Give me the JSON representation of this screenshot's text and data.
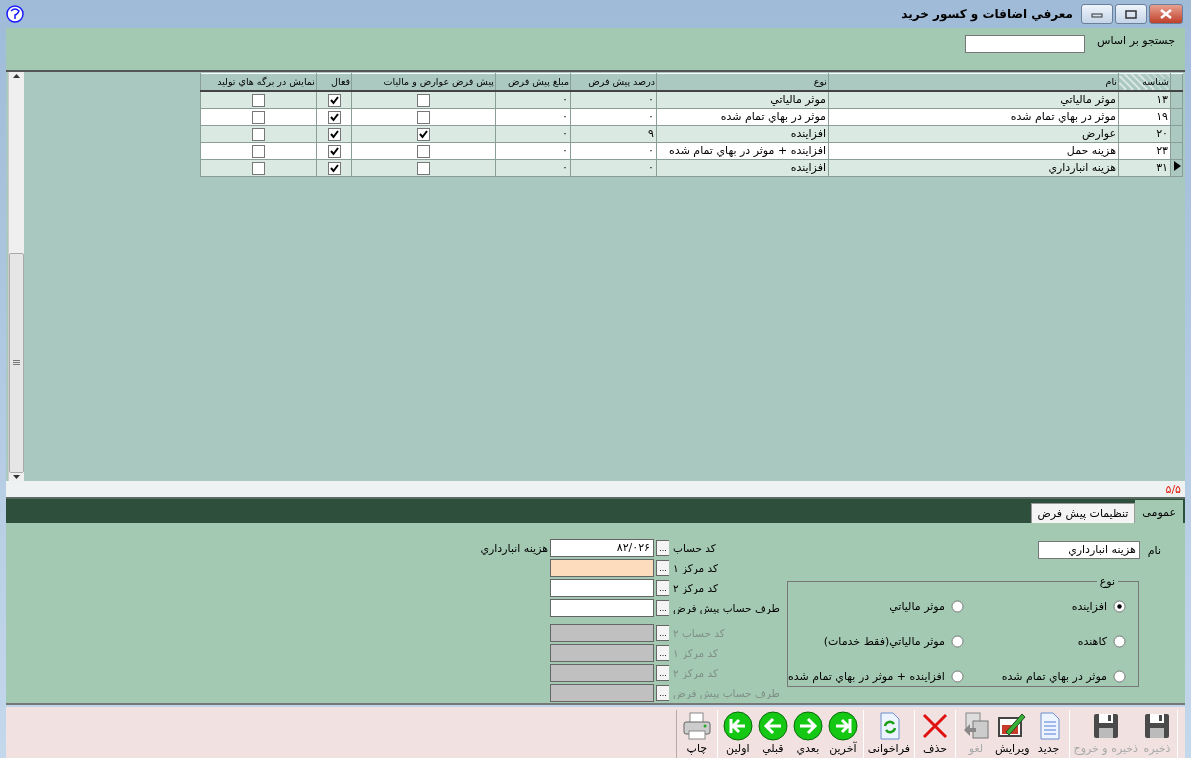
{
  "window": {
    "title": "معرفي اضافات و کسور خريد"
  },
  "search": {
    "label": "جستجو بر اساس"
  },
  "grid": {
    "columns": [
      {
        "label": "شناسه",
        "sorted": true
      },
      {
        "label": "نام",
        "sorted": false
      },
      {
        "label": "نوع",
        "sorted": false
      },
      {
        "label": "درصد پیش فرض",
        "sorted": false
      },
      {
        "label": "مبلغ پیش فرض",
        "sorted": false
      },
      {
        "label": "پیش فرض عوارض و مالیات",
        "sorted": false
      },
      {
        "label": "فعال",
        "sorted": false
      },
      {
        "label": "نمایش در برگه هاي تولید",
        "sorted": false
      }
    ],
    "rows": [
      {
        "current": false,
        "id": "۱۳",
        "name": "موثر مالیاتي",
        "type": "موثر مالیاتي",
        "percent": "۰",
        "amount": "۰",
        "tax_default": false,
        "active": true,
        "show_in_production": false
      },
      {
        "current": false,
        "id": "۱۹",
        "name": "موثر در بهاي تمام شده",
        "type": "موثر در بهاي تمام شده",
        "percent": "۰",
        "amount": "۰",
        "tax_default": false,
        "active": true,
        "show_in_production": false
      },
      {
        "current": false,
        "id": "۲۰",
        "name": "عوارض",
        "type": "افزاینده",
        "percent": "۹",
        "amount": "۰",
        "tax_default": true,
        "active": true,
        "show_in_production": false
      },
      {
        "current": false,
        "id": "۲۳",
        "name": "هزینه حمل",
        "type": "افزاینده + موثر در بهاي تمام شده",
        "percent": "۰",
        "amount": "۰",
        "tax_default": false,
        "active": true,
        "show_in_production": false
      },
      {
        "current": true,
        "id": "۳۱",
        "name": "هزینه انبارداري",
        "type": "افزاینده",
        "percent": "۰",
        "amount": "۰",
        "tax_default": false,
        "active": true,
        "show_in_production": false
      }
    ],
    "counter": "۵/۵"
  },
  "tabs": [
    {
      "label": "عمومی",
      "selected": true
    },
    {
      "label": "تنظیمات پیش فرض",
      "selected": false
    }
  ],
  "form": {
    "name_label": "نام",
    "name_value": "هزینه انبارداري",
    "type_group": {
      "title": "نوع",
      "options": [
        {
          "label": "افزاینده",
          "selected": true
        },
        {
          "label": "موثر مالیاتي",
          "selected": false
        },
        {
          "label": "کاهنده",
          "selected": false
        },
        {
          "label": "موثر مالیاتي(فقط خدمات)",
          "selected": false
        },
        {
          "label": "موثر در بهاي تمام شده",
          "selected": false
        },
        {
          "label": "افزاینده + موثر در بهاي تمام شده",
          "selected": false
        }
      ]
    },
    "account_fields": [
      {
        "label": "کد حساب",
        "value": "۸۲/۰۲۶",
        "button": "...",
        "note": "هزینه انبارداري",
        "disabled": false,
        "highlighted": false
      },
      {
        "label": "کد مرکز ۱",
        "button": "...",
        "disabled": false,
        "highlighted": true
      },
      {
        "label": "کد مرکز ۲",
        "button": "...",
        "disabled": false,
        "highlighted": false
      },
      {
        "label": "طرف حساب پیش فرض",
        "button": "...",
        "disabled": false,
        "highlighted": false
      },
      {
        "label": "کد حساب ۲",
        "button": "...",
        "disabled": true,
        "highlighted": false
      },
      {
        "label": "کد مرکز ۱",
        "button": "...",
        "disabled": true,
        "highlighted": false
      },
      {
        "label": "کد مرکز ۲",
        "button": "...",
        "disabled": true,
        "highlighted": false
      },
      {
        "label": "طرف حساب پیش فرض",
        "button": "...",
        "disabled": true,
        "highlighted": false
      }
    ]
  },
  "toolbar": [
    [
      {
        "label": "ذخیره",
        "kind": "save",
        "disabled": true
      },
      {
        "label": "ذخیره و خروج",
        "kind": "save",
        "disabled": true
      }
    ],
    [
      {
        "label": "جدید",
        "kind": "new",
        "disabled": false
      },
      {
        "label": "ویرایش",
        "kind": "edit",
        "disabled": false
      },
      {
        "label": "لغو",
        "kind": "undo",
        "disabled": true
      }
    ],
    [
      {
        "label": "حذف",
        "kind": "delete",
        "disabled": false
      }
    ],
    [
      {
        "label": "فراخوانی",
        "kind": "reload",
        "disabled": false
      }
    ],
    [
      {
        "label": "آخرین",
        "kind": "last",
        "disabled": false
      },
      {
        "label": "بعدي",
        "kind": "next",
        "disabled": false
      },
      {
        "label": "قبلي",
        "kind": "prev",
        "disabled": false
      },
      {
        "label": "اولین",
        "kind": "first",
        "disabled": false
      }
    ],
    [
      {
        "label": "چاپ",
        "kind": "print",
        "disabled": false
      }
    ]
  ]
}
